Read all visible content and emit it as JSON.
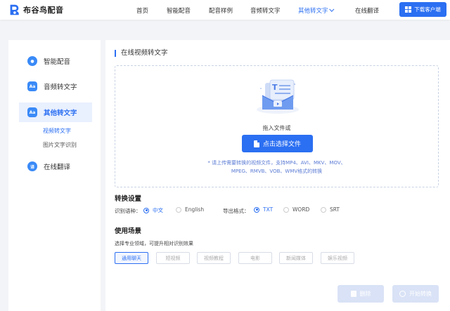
{
  "brand": {
    "name": "布谷鸟配音"
  },
  "nav": {
    "items": [
      "首页",
      "智能配音",
      "配音样例",
      "音频转文字",
      "其他转文字",
      "在线翻译"
    ],
    "download_label": "下载客户端"
  },
  "sidebar": {
    "items": [
      {
        "label": "智能配音",
        "icon": "microphone-icon"
      },
      {
        "label": "音频转文字",
        "icon": "aa-icon"
      },
      {
        "label": "其他转文字",
        "icon": "aa-icon"
      },
      {
        "label": "在线翻译",
        "icon": "translate-icon"
      }
    ],
    "sub_items": [
      "视频转文字",
      "图片文字识别"
    ]
  },
  "main": {
    "title": "在线视频转文字",
    "upload": {
      "drop_text": "拖入文件或",
      "choose_label": "点击选择文件",
      "hint_line1": "* 请上传需要转换的视频文件，支持MP4、AVI、MKV、MOV、",
      "hint_line2": "MPEG、RMVB、VOB、WMV格式的转换"
    },
    "settings": {
      "title": "转换设置",
      "lang_label": "识别语种：",
      "lang_options": [
        "中文",
        "English"
      ],
      "format_label": "导出格式：",
      "format_options": [
        "TXT",
        "WORD",
        "SRT"
      ]
    },
    "scene": {
      "title": "使用场景",
      "desc": "选择专业领域，可提升相对识别效果",
      "options": [
        "通用聊天",
        "短视频",
        "视频教程",
        "电影",
        "新闻媒体",
        "娱乐视频"
      ]
    },
    "actions": {
      "delete_label": "删除",
      "start_label": "开始转换"
    }
  },
  "colors": {
    "accent": "#2b6ff2",
    "disabled": "#d9e2f6"
  }
}
